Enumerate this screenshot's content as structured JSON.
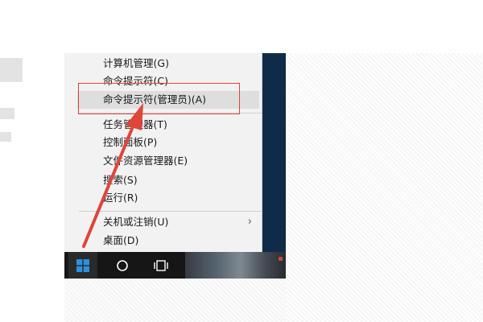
{
  "start_menu": {
    "items": [
      {
        "label": "计算机管理(G)"
      },
      {
        "label": "命令提示符(C)"
      },
      {
        "label": "命令提示符(管理员)(A)"
      },
      {
        "label": "任务管理器(T)"
      },
      {
        "label": "控制面板(P)"
      },
      {
        "label": "文件资源管理器(E)"
      },
      {
        "label": "搜索(S)"
      },
      {
        "label": "运行(R)"
      },
      {
        "label": "关机或注销(U)"
      },
      {
        "label": "桌面(D)"
      }
    ],
    "submenu_arrow": "›",
    "highlighted_item_index": 2
  },
  "annotation": {
    "box_color": "#e0453a",
    "arrow_color": "#e0453a"
  },
  "taskbar": {
    "icons": [
      "windows-logo-icon",
      "cortana-circle-icon",
      "task-view-icon"
    ]
  }
}
